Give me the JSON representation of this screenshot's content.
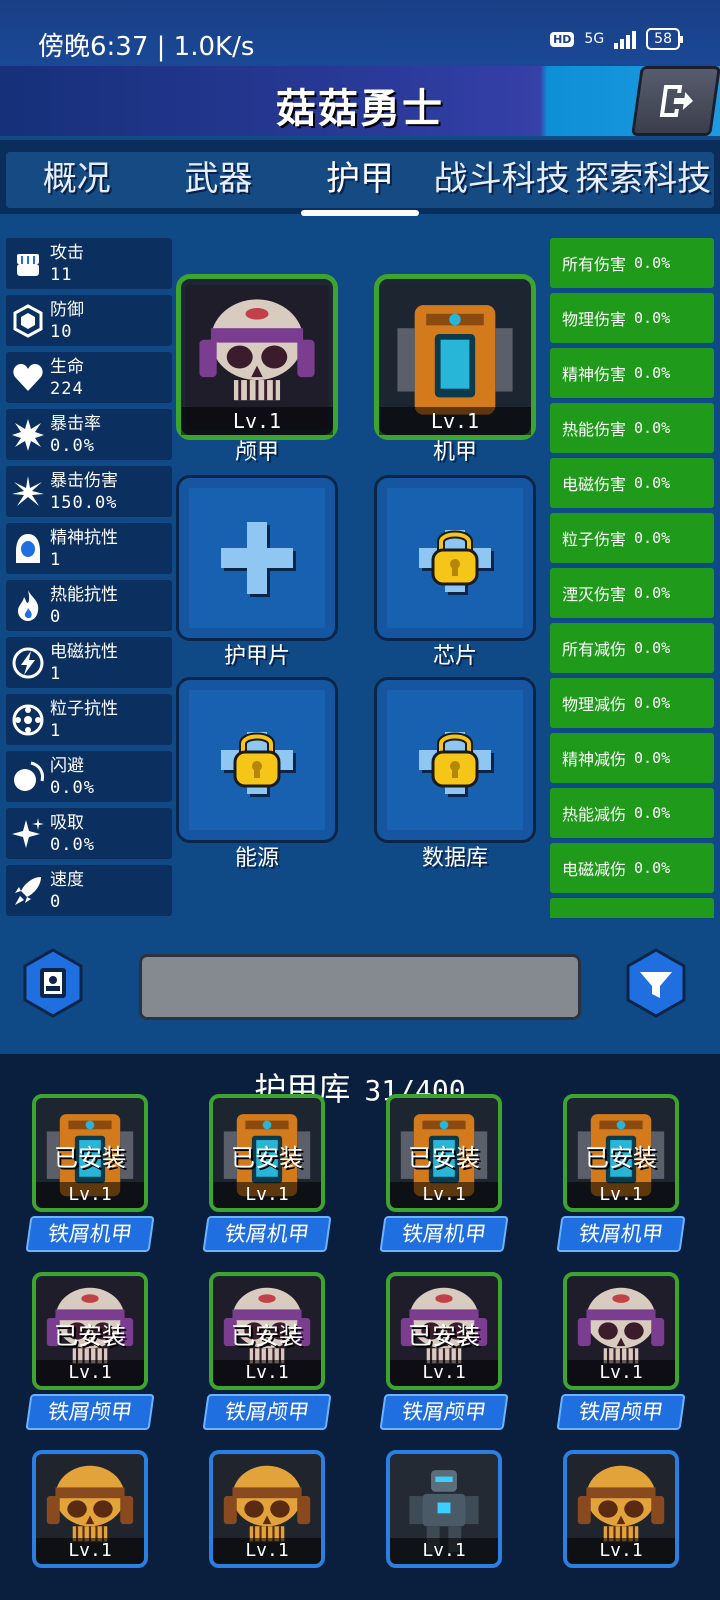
{
  "status_bar": {
    "time_text": "傍晚6:37 | 1.0K/s",
    "network": "5G",
    "hd": "HD",
    "battery": "58"
  },
  "header": {
    "title": "菇菇勇士"
  },
  "tabs": [
    {
      "label": "概况"
    },
    {
      "label": "武器"
    },
    {
      "label": "护甲"
    },
    {
      "label": "战斗科技"
    },
    {
      "label": "探索科技"
    }
  ],
  "active_tab": 2,
  "stats": [
    {
      "label": "攻击",
      "value": "11",
      "icon": "fist-icon"
    },
    {
      "label": "防御",
      "value": "10",
      "icon": "hexagon-shield-icon"
    },
    {
      "label": "生命",
      "value": "224",
      "icon": "heart-icon"
    },
    {
      "label": "暴击率",
      "value": "0.0%",
      "icon": "burst-icon"
    },
    {
      "label": "暴击伤害",
      "value": "150.0%",
      "icon": "star-burst-icon"
    },
    {
      "label": "精神抗性",
      "value": "1",
      "icon": "hooded-figure-icon"
    },
    {
      "label": "热能抗性",
      "value": "0",
      "icon": "flame-icon"
    },
    {
      "label": "电磁抗性",
      "value": "1",
      "icon": "lightning-icon"
    },
    {
      "label": "粒子抗性",
      "value": "1",
      "icon": "atom-icon"
    },
    {
      "label": "闪避",
      "value": "0.0%",
      "icon": "dodge-icon"
    },
    {
      "label": "吸取",
      "value": "0.0%",
      "icon": "sparkle-icon"
    },
    {
      "label": "速度",
      "value": "0",
      "icon": "rocket-icon"
    }
  ],
  "bonuses": [
    {
      "label": "所有伤害",
      "value": "0.0%"
    },
    {
      "label": "物理伤害",
      "value": "0.0%"
    },
    {
      "label": "精神伤害",
      "value": "0.0%"
    },
    {
      "label": "热能伤害",
      "value": "0.0%"
    },
    {
      "label": "电磁伤害",
      "value": "0.0%"
    },
    {
      "label": "粒子伤害",
      "value": "0.0%"
    },
    {
      "label": "湮灭伤害",
      "value": "0.0%"
    },
    {
      "label": "所有减伤",
      "value": "0.0%"
    },
    {
      "label": "物理减伤",
      "value": "0.0%"
    },
    {
      "label": "精神减伤",
      "value": "0.0%"
    },
    {
      "label": "热能减伤",
      "value": "0.0%"
    },
    {
      "label": "电磁减伤",
      "value": "0.0%"
    },
    {
      "label": "",
      "value": ""
    }
  ],
  "slots": [
    {
      "label": "颅甲",
      "level": "Lv.1",
      "state": "equipped",
      "art": "skull-helmet-icon"
    },
    {
      "label": "机甲",
      "level": "Lv.1",
      "state": "equipped",
      "art": "mech-armor-icon"
    },
    {
      "label": "护甲片",
      "state": "add",
      "art": "plus-icon"
    },
    {
      "label": "芯片",
      "state": "locked",
      "art": "lock-icon"
    },
    {
      "label": "能源",
      "state": "locked",
      "art": "lock-icon"
    },
    {
      "label": "数据库",
      "state": "locked",
      "art": "lock-icon"
    }
  ],
  "library": {
    "title": "护甲库",
    "count": "31/400",
    "installed_label": "已安装",
    "items": [
      {
        "name": "铁屑机甲",
        "level": "Lv.1",
        "installed": true,
        "art": "mech",
        "rarity": "green"
      },
      {
        "name": "铁屑机甲",
        "level": "Lv.1",
        "installed": true,
        "art": "mech",
        "rarity": "green"
      },
      {
        "name": "铁屑机甲",
        "level": "Lv.1",
        "installed": true,
        "art": "mech",
        "rarity": "green"
      },
      {
        "name": "铁屑机甲",
        "level": "Lv.1",
        "installed": true,
        "art": "mech",
        "rarity": "green"
      },
      {
        "name": "铁屑颅甲",
        "level": "Lv.1",
        "installed": true,
        "art": "skull",
        "rarity": "green"
      },
      {
        "name": "铁屑颅甲",
        "level": "Lv.1",
        "installed": true,
        "art": "skull",
        "rarity": "green"
      },
      {
        "name": "铁屑颅甲",
        "level": "Lv.1",
        "installed": true,
        "art": "skull",
        "rarity": "green"
      },
      {
        "name": "铁屑颅甲",
        "level": "Lv.1",
        "installed": false,
        "art": "skull",
        "rarity": "green"
      },
      {
        "name": "",
        "level": "Lv.1",
        "installed": false,
        "art": "gold-skull",
        "rarity": "blue"
      },
      {
        "name": "",
        "level": "Lv.1",
        "installed": false,
        "art": "gold-skull",
        "rarity": "blue"
      },
      {
        "name": "",
        "level": "Lv.1",
        "installed": false,
        "art": "robot",
        "rarity": "blue"
      },
      {
        "name": "",
        "level": "Lv.1",
        "installed": false,
        "art": "gold-skull",
        "rarity": "blue"
      }
    ]
  },
  "colors": {
    "bonus_green": "#1f9a1b",
    "equipped_border": "#3da52e",
    "rare_border": "#2a7fe0",
    "panel_blue": "#0f4a86"
  }
}
